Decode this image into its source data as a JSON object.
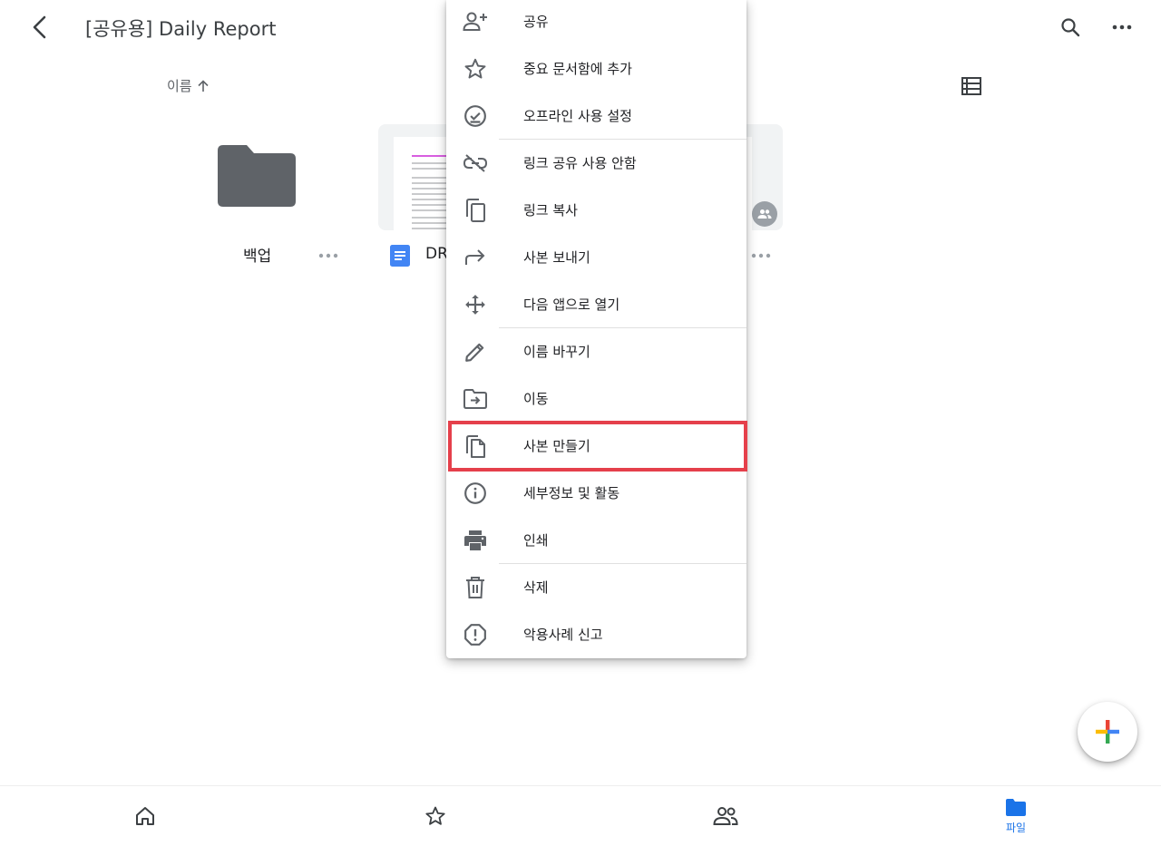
{
  "header": {
    "title": "[공유용] Daily Report",
    "back_icon": "back-arrow-icon",
    "search_icon": "search-icon",
    "more_icon": "more-horizontal-icon"
  },
  "sort": {
    "label": "이름",
    "direction_icon": "arrow-up-icon",
    "view_toggle_icon": "list-view-icon"
  },
  "files": [
    {
      "name": "백업",
      "type": "folder",
      "icon": "folder-icon"
    },
    {
      "name": "DR",
      "type": "google-doc",
      "icon": "docs-icon",
      "shared": true
    }
  ],
  "menu": {
    "items": [
      {
        "label": "공유",
        "icon": "person-add-icon"
      },
      {
        "label": "중요 문서함에 추가",
        "icon": "star-icon"
      },
      {
        "label": "오프라인 사용 설정",
        "icon": "offline-check-icon"
      },
      {
        "label": "링크 공유 사용 안함",
        "icon": "link-off-icon"
      },
      {
        "label": "링크 복사",
        "icon": "copy-icon"
      },
      {
        "label": "사본 보내기",
        "icon": "forward-icon"
      },
      {
        "label": "다음 앱으로 열기",
        "icon": "open-with-icon"
      },
      {
        "label": "이름 바꾸기",
        "icon": "pencil-icon"
      },
      {
        "label": "이동",
        "icon": "move-to-folder-icon"
      },
      {
        "label": "사본 만들기",
        "icon": "file-copy-icon",
        "highlighted": true
      },
      {
        "label": "세부정보 및 활동",
        "icon": "info-icon"
      },
      {
        "label": "인쇄",
        "icon": "print-icon"
      },
      {
        "label": "삭제",
        "icon": "trash-icon"
      },
      {
        "label": "악용사례 신고",
        "icon": "report-icon"
      }
    ],
    "highlight_color": "#e5404b"
  },
  "fab": {
    "icon": "plus-multicolor-icon"
  },
  "bottom_nav": {
    "items": [
      {
        "label": "",
        "icon": "home-icon"
      },
      {
        "label": "",
        "icon": "star-icon"
      },
      {
        "label": "",
        "icon": "shared-people-icon"
      },
      {
        "label": "파일",
        "icon": "folder-icon",
        "active": true
      }
    ],
    "active_color": "#1a73e8"
  }
}
